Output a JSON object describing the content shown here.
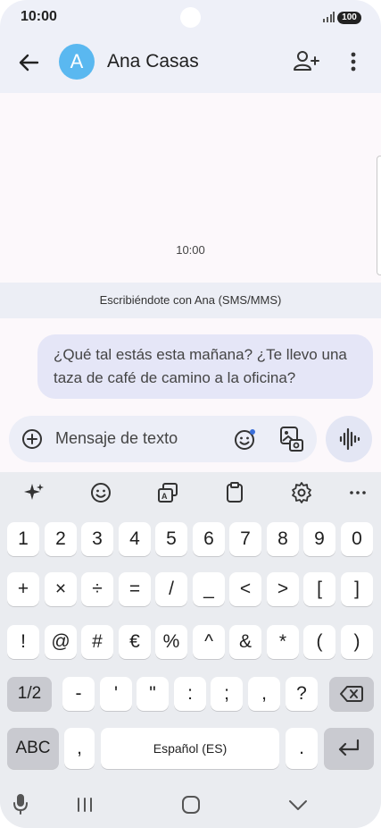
{
  "status": {
    "time": "10:00",
    "battery": "100"
  },
  "header": {
    "avatar_initial": "A",
    "contact_name": "Ana Casas"
  },
  "conversation": {
    "timestamp": "10:00",
    "info": "Escribiéndote con Ana (SMS/MMS)",
    "messages": [
      {
        "text_line1": "¿Qué tal estás esta mañana? ¿Te llevo una",
        "text_line2": "taza de café de camino a la oficina?"
      }
    ]
  },
  "compose": {
    "placeholder": "Mensaje de texto"
  },
  "keyboard": {
    "row1": [
      "1",
      "2",
      "3",
      "4",
      "5",
      "6",
      "7",
      "8",
      "9",
      "0"
    ],
    "row2": [
      "+",
      "×",
      "÷",
      "=",
      "/",
      "_",
      "<",
      ">",
      "[",
      "]"
    ],
    "row3": [
      "!",
      "@",
      "#",
      "€",
      "%",
      "^",
      "&",
      "*",
      "(",
      ")"
    ],
    "row4": [
      "-",
      "'",
      "\"",
      ":",
      ";",
      ",",
      "?"
    ],
    "page_toggle": "1/2",
    "abc": "ABC",
    "comma": ",",
    "space": "Español (ES)",
    "period": "."
  }
}
